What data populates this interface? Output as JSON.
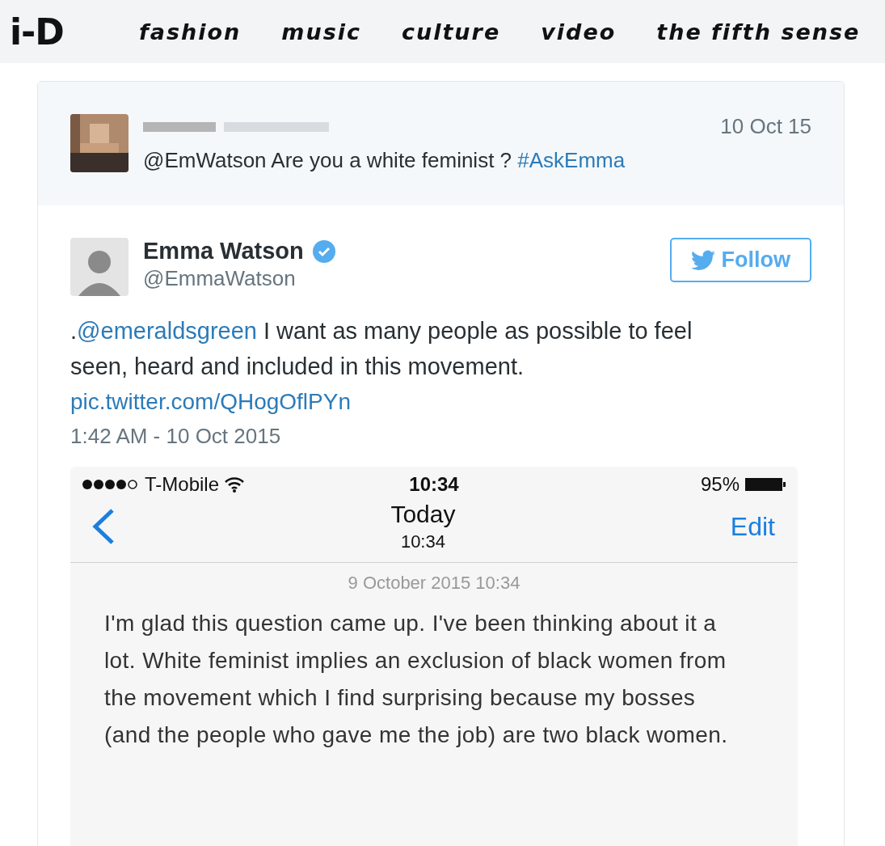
{
  "site": {
    "logo": "i-D",
    "nav": [
      "fashion",
      "music",
      "culture",
      "video",
      "the fifth sense"
    ]
  },
  "parent_tweet": {
    "date": "10 Oct 15",
    "parts": [
      {
        "text": "@EmWatson Are you a white feminist ? ",
        "link": false
      },
      {
        "text": "#AskEmma",
        "link": true
      }
    ]
  },
  "tweet": {
    "name": "Emma Watson",
    "verified": true,
    "handle": "@EmmaWatson",
    "follow": "Follow",
    "parts": [
      {
        "text": ".",
        "link": false
      },
      {
        "text": "@emeraldsgreen",
        "link": true
      },
      {
        "text": " I want as many people as possible to feel seen, heard and included in this movement.",
        "link": false
      }
    ],
    "pic_link": "pic.twitter.com/QHogOflPYn",
    "timestamp": "1:42 AM - 10 Oct 2015"
  },
  "phone": {
    "carrier": "T-Mobile",
    "time": "10:34",
    "battery": "95%",
    "title": "Today",
    "subtitle": "10:34",
    "edit": "Edit",
    "note_date": "9 October 2015 10:34",
    "note": "I'm glad this question came up. I've been thinking about it a lot. White feminist implies an exclusion of black women from the movement which I find surprising because my bosses (and the people who gave me the job) are two black women."
  }
}
